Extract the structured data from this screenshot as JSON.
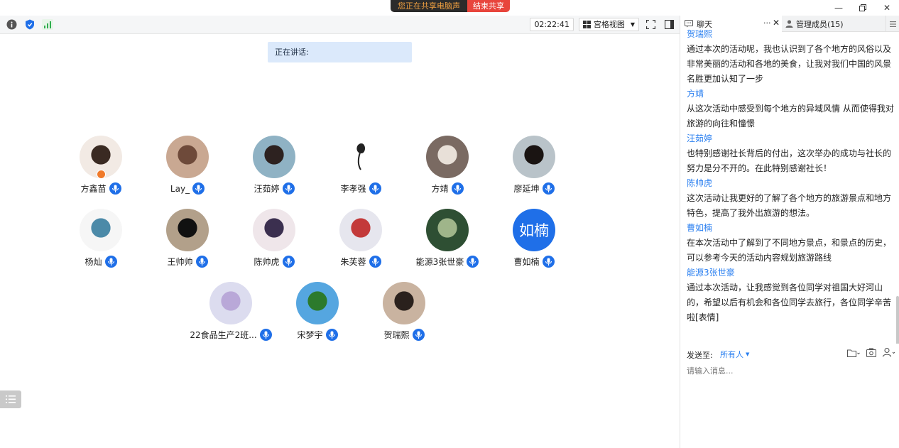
{
  "share_banner": {
    "status": "您正在共享电脑声音",
    "stop_label": "结束共享"
  },
  "toolbar": {
    "timer": "02:22:41",
    "view_mode": "宫格视图"
  },
  "speaking": {
    "label": "正在讲话:"
  },
  "participants": [
    {
      "name": "方鑫苗",
      "avatar": "cartoon-boy"
    },
    {
      "name": "Lay_",
      "avatar": "photo"
    },
    {
      "name": "汪茹婷",
      "avatar": "photo"
    },
    {
      "name": "李孝强",
      "avatar": "flower"
    },
    {
      "name": "方靖",
      "avatar": "photo"
    },
    {
      "name": "廖延坤",
      "avatar": "photo"
    },
    {
      "name": "杨灿",
      "avatar": "cartoon-girl"
    },
    {
      "name": "王帅帅",
      "avatar": "photo"
    },
    {
      "name": "陈帅虎",
      "avatar": "photo"
    },
    {
      "name": "朱芙蓉",
      "avatar": "photo"
    },
    {
      "name": "能源3张世豪",
      "avatar": "photo"
    },
    {
      "name": "曹如楠",
      "avatar": "text",
      "avatar_text": "如楠"
    },
    {
      "name": "22食品生产2班...",
      "avatar": "flowers"
    },
    {
      "name": "宋梦宇",
      "avatar": "photo"
    },
    {
      "name": "贺瑞熙",
      "avatar": "photo"
    }
  ],
  "panel": {
    "chat_tab": "聊天",
    "members_tab": "管理成员(15)",
    "more": "···",
    "send_to_label": "发送至:",
    "send_target": "所有人",
    "input_placeholder": "请输入消息..."
  },
  "messages": [
    {
      "sender": "贺瑞熙",
      "text": ""
    },
    {
      "sender": "",
      "text": "通过本次的活动呢，我也认识到了各个地方的风俗以及非常美丽的活动和各地的美食，让我对我们中国的风景名胜更加认知了一步"
    },
    {
      "sender": "方靖",
      "text": "从这次活动中感受到每个地方的异域风情 从而使得我对旅游的向往和憧憬"
    },
    {
      "sender": "汪茹婷",
      "text": "也特别感谢社长背后的付出，这次举办的成功与社长的努力是分不开的。在此特别感谢社长！"
    },
    {
      "sender": "陈帅虎",
      "text": "这次活动让我更好的了解了各个地方的旅游景点和地方特色，提高了我外出旅游的想法。"
    },
    {
      "sender": "曹如楠",
      "text": "在本次活动中了解到了不同地方景点，和景点的历史，可以参考今天的活动内容规划旅游路线"
    },
    {
      "sender": "能源3张世豪",
      "text": "通过本次活动，让我感觉到各位同学对祖国大好河山的，希望以后有机会和各位同学去旅行，各位同学辛苦啦[表情]"
    }
  ],
  "colors": {
    "accent": "#2a7ff0",
    "stop": "#e8453c",
    "mic": "#1f6fe8",
    "speaking_bg": "#dbe9fb"
  }
}
